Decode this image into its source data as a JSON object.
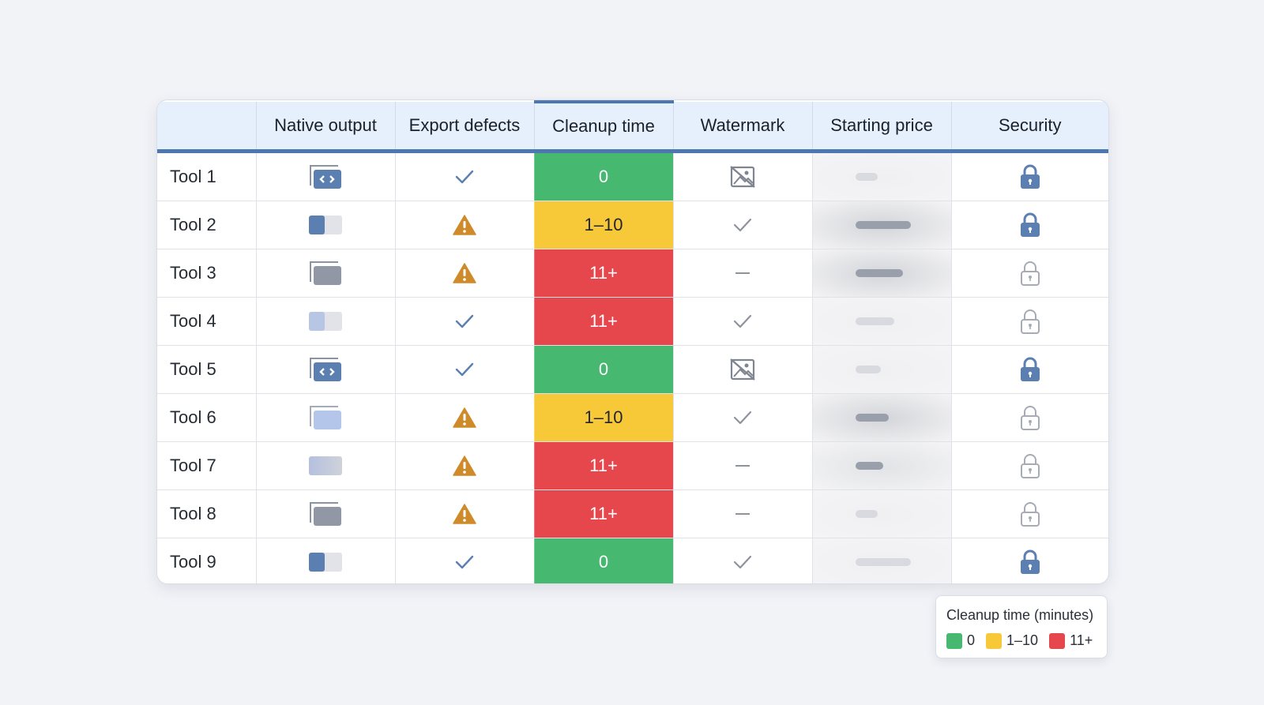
{
  "header": {
    "columns": [
      "",
      "Native output",
      "Export defects",
      "Cleanup time",
      "Watermark",
      "Starting price",
      "Security"
    ]
  },
  "rows": [
    {
      "name": "Tool 1",
      "native": "layered-code-icon",
      "defect": "check",
      "cleanup": "0",
      "cleanup_level": "green",
      "watermark": "no-watermark",
      "price_bar": 0.4,
      "price_shade": "light",
      "security": "locked"
    },
    {
      "name": "Tool 2",
      "native": "toggle-dark",
      "defect": "warning",
      "cleanup": "1–10",
      "cleanup_level": "yellow",
      "watermark": "check",
      "price_bar": 1.0,
      "price_shade": "dark",
      "security": "locked"
    },
    {
      "name": "Tool 3",
      "native": "stack-gray",
      "defect": "warning",
      "cleanup": "11+",
      "cleanup_level": "red",
      "watermark": "dash",
      "price_bar": 0.85,
      "price_shade": "dark",
      "security": "unlocked"
    },
    {
      "name": "Tool 4",
      "native": "toggle-light",
      "defect": "check",
      "cleanup": "11+",
      "cleanup_level": "red",
      "watermark": "check",
      "price_bar": 0.7,
      "price_shade": "light",
      "security": "unlocked"
    },
    {
      "name": "Tool 5",
      "native": "layered-code-icon",
      "defect": "check",
      "cleanup": "0",
      "cleanup_level": "green",
      "watermark": "no-watermark",
      "price_bar": 0.45,
      "price_shade": "light",
      "security": "locked"
    },
    {
      "name": "Tool 6",
      "native": "stack-light",
      "defect": "warning",
      "cleanup": "1–10",
      "cleanup_level": "yellow",
      "watermark": "check",
      "price_bar": 0.6,
      "price_shade": "dark",
      "security": "unlocked"
    },
    {
      "name": "Tool 7",
      "native": "toggle-mid",
      "defect": "warning",
      "cleanup": "11+",
      "cleanup_level": "red",
      "watermark": "dash",
      "price_bar": 0.5,
      "price_shade": "mid",
      "security": "unlocked"
    },
    {
      "name": "Tool 8",
      "native": "stack-gray",
      "defect": "warning",
      "cleanup": "11+",
      "cleanup_level": "red",
      "watermark": "dash",
      "price_bar": 0.4,
      "price_shade": "light",
      "security": "unlocked"
    },
    {
      "name": "Tool 9",
      "native": "toggle-dark",
      "defect": "check",
      "cleanup": "0",
      "cleanup_level": "green",
      "watermark": "check",
      "price_bar": 1.0,
      "price_shade": "light",
      "security": "locked"
    }
  ],
  "legend": {
    "title": "Cleanup time (minutes)",
    "items": [
      {
        "label": "0",
        "level": "green"
      },
      {
        "label": "1–10",
        "level": "yellow"
      },
      {
        "label": "11+",
        "level": "red"
      }
    ]
  },
  "colors": {
    "green": "#46b86f",
    "yellow": "#f7c938",
    "red": "#e5474d",
    "accent": "#4d77b0",
    "header_bg": "#e6f0fc",
    "warning": "#cf8a2a",
    "check": "#5a7fb0"
  }
}
